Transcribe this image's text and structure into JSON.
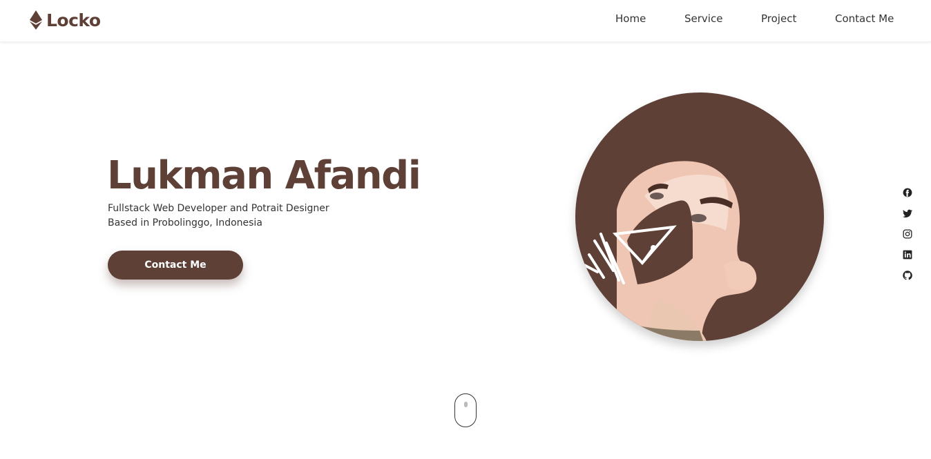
{
  "brand": {
    "name": "Locko"
  },
  "nav": {
    "items": [
      {
        "label": "Home"
      },
      {
        "label": "Service"
      },
      {
        "label": "Project"
      },
      {
        "label": "Contact Me"
      }
    ]
  },
  "hero": {
    "name": "Lukman Afandi",
    "subtitle_line1": "Fullstack Web Developer and Potrait Designer",
    "subtitle_line2": "Based in Probolinggo, Indonesia",
    "cta_label": "Contact Me"
  },
  "social": [
    "facebook-icon",
    "twitter-icon",
    "instagram-icon",
    "linkedin-icon",
    "github-icon"
  ],
  "colors": {
    "primary": "#5e4037",
    "text": "#333333",
    "background": "#ffffff"
  }
}
